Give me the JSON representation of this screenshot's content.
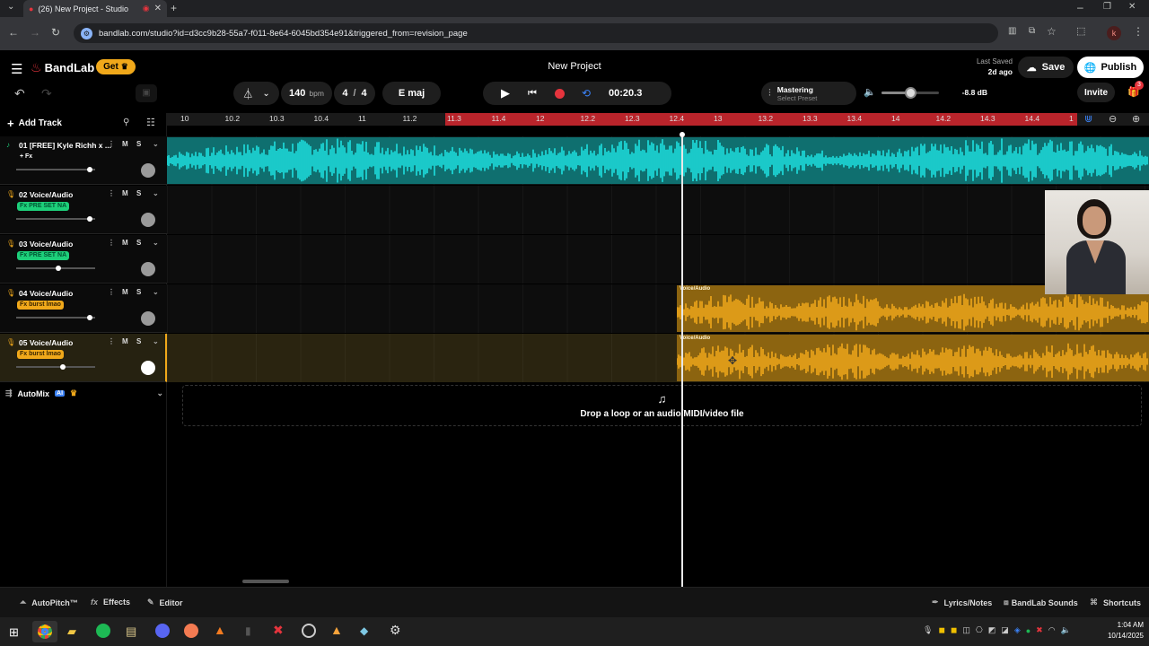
{
  "browser": {
    "tab_title": "(26) New Project - Studio",
    "url": "bandlab.com/studio?id=d3cc9b28-55a7-f011-8e64-6045bd354e91&triggered_from=revision_page"
  },
  "header": {
    "brand": "BandLab",
    "get_label": "Get",
    "project_title": "New Project",
    "last_saved_label": "Last Saved",
    "last_saved_time": "2d ago",
    "save_label": "Save",
    "publish_label": "Publish",
    "invite_label": "Invite",
    "gift_badge": "3"
  },
  "transport": {
    "bpm": "140",
    "bpm_unit": "bpm",
    "time_sig_num": "4",
    "time_sig_sep": "/",
    "time_sig_den": "4",
    "key": "E maj",
    "time": "00:20.3",
    "mastering_label": "Mastering",
    "mastering_preset": "Select Preset",
    "volume_db": "-8.8 dB",
    "volume_level": 0.5
  },
  "toolbar": {
    "add_track_label": "Add Track"
  },
  "ruler": {
    "ticks": [
      "10",
      "10.2",
      "10.3",
      "10.4",
      "11",
      "11.2",
      "11.3",
      "11.4",
      "12",
      "12.2",
      "12.3",
      "12.4",
      "13",
      "13.2",
      "13.3",
      "13.4",
      "14",
      "14.2",
      "14.3",
      "14.4",
      "1"
    ]
  },
  "tracks": [
    {
      "name": "01  [FREE] Kyle Richh x ...",
      "badge": "+ Fx",
      "badge_style": "plain",
      "mute": "M",
      "solo": "S",
      "volume": 0.95
    },
    {
      "name": "02  Voice/Audio",
      "badge": "Fx PRE SET NA",
      "badge_style": "green",
      "mute": "M",
      "solo": "S",
      "volume": 0.95
    },
    {
      "name": "03  Voice/Audio",
      "badge": "Fx PRE SET NA",
      "badge_style": "green",
      "mute": "M",
      "solo": "S",
      "volume": 0.55
    },
    {
      "name": "04  Voice/Audio",
      "badge": "Fx burst lmao",
      "badge_style": "orange",
      "mute": "M",
      "solo": "S",
      "volume": 0.95
    },
    {
      "name": "05  Voice/Audio",
      "badge": "Fx burst lmao",
      "badge_style": "orange",
      "mute": "M",
      "solo": "S",
      "volume": 0.6
    }
  ],
  "clips": {
    "track4_label": "Voice/Audio",
    "track5_label": "Voice/Audio"
  },
  "automix": {
    "label": "AutoMix",
    "ai_badge": "AI"
  },
  "dropzone": {
    "text": "Drop a loop or an audio/MIDI/video file"
  },
  "bottombar": {
    "autopitch": "AutoPitch™",
    "effects": "Effects",
    "editor": "Editor",
    "lyrics": "Lyrics/Notes",
    "sounds": "BandLab Sounds",
    "shortcuts": "Shortcuts"
  },
  "taskbar": {
    "time": "1:04 AM",
    "date": "10/14/2025"
  },
  "colors": {
    "accent_red": "#e5343d",
    "track1_wave": "#1ee0e0",
    "track45_wave": "#f0a81a",
    "green_badge": "#1dcf7a",
    "orange_badge": "#f0a81a",
    "ruler_loop": "#b9242b"
  }
}
